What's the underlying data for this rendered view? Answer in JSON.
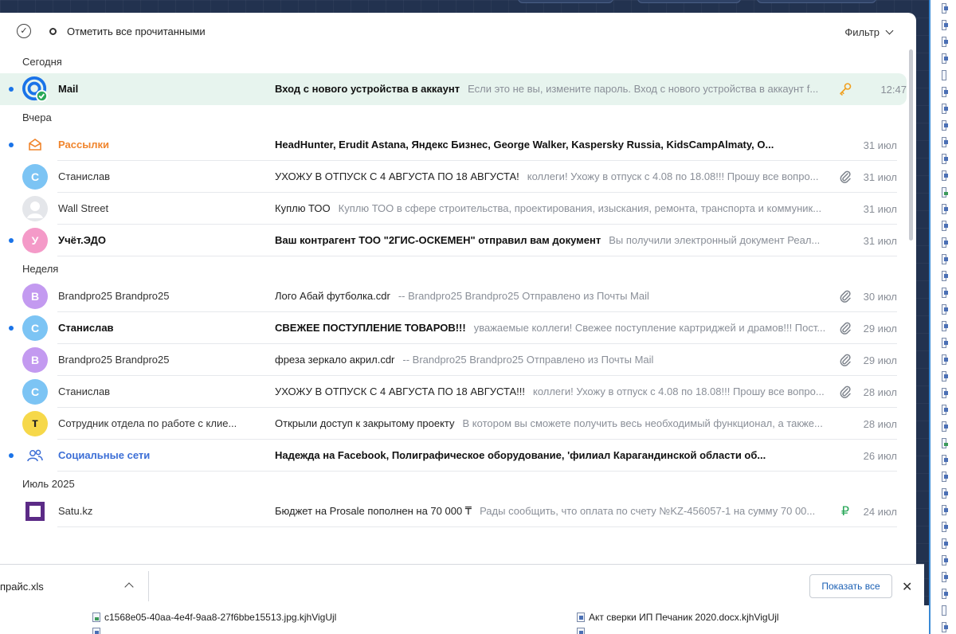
{
  "toolbar": {
    "mark_all_read": "Отметить все прочитанными",
    "filter": "Фильтр"
  },
  "groups": [
    {
      "title": "Сегодня",
      "items": [
        {
          "sender": "Mail",
          "subject": "Вход с нового устройства в аккаунт",
          "preview": "Если это не вы, измените пароль. Вход с нового устройства в аккаунт f...",
          "date": "12:47",
          "unread": true,
          "bold": true,
          "icon": "key-icon",
          "avatar_type": "mail-logo",
          "highlight": true
        }
      ]
    },
    {
      "title": "Вчера",
      "items": [
        {
          "sender": "Рассылки",
          "subject": "HeadHunter, Erudit Astana, Яндекс Бизнес, George Walker, Kaspersky Russia, KidsCampAlmaty, О...",
          "preview": "",
          "date": "31 июл",
          "unread": true,
          "bold": true,
          "avatar_type": "newsletter",
          "sender_color": "#f0852d"
        },
        {
          "sender": "Станислав",
          "subject": "УХОЖУ В ОТПУСК С 4 АВГУСТА ПО 18 АВГУСТА!",
          "preview": "коллеги! Ухожу в отпуск с 4.08 по 18.08!!! Прошу все вопро...",
          "date": "31 июл",
          "unread": false,
          "bold": false,
          "icon": "paperclip-icon",
          "avatar_letter": "С",
          "avatar_color": "#7cc4f4"
        },
        {
          "sender": "Wall Street",
          "subject": "Куплю ТОО",
          "preview": "Куплю ТОО в сфере строительства, проектирования, изыскания, ремонта, транспорта и коммуник...",
          "date": "31 июл",
          "unread": false,
          "bold": false,
          "avatar_type": "person"
        },
        {
          "sender": "Учёт.ЭДО",
          "subject": "Ваш контрагент ТОО \"2ГИС-ОСКЕМЕН\" отправил вам документ",
          "preview": "Вы получили электронный документ Реал...",
          "date": "31 июл",
          "unread": true,
          "bold": true,
          "avatar_letter": "У",
          "avatar_color": "#f49ac8"
        }
      ]
    },
    {
      "title": "Неделя",
      "items": [
        {
          "sender": "Brandpro25 Brandpro25",
          "subject": "Лого Абай футболка.cdr",
          "preview": "-- Brandpro25 Brandpro25 Отправлено из Почты Mail",
          "date": "30 июл",
          "unread": false,
          "bold": false,
          "icon": "paperclip-icon",
          "avatar_letter": "B",
          "avatar_color": "#c39af0"
        },
        {
          "sender": "Станислав",
          "subject": "СВЕЖЕЕ ПОСТУПЛЕНИЕ ТОВАРОВ!!!",
          "preview": "уважаемые коллеги! Свежее поступление картриджей и драмов!!! Пост...",
          "date": "29 июл",
          "unread": true,
          "bold": true,
          "icon": "paperclip-icon",
          "avatar_letter": "С",
          "avatar_color": "#7cc4f4"
        },
        {
          "sender": "Brandpro25 Brandpro25",
          "subject": "фреза зеркало акрил.cdr",
          "preview": "-- Brandpro25 Brandpro25 Отправлено из Почты Mail",
          "date": "29 июл",
          "unread": false,
          "bold": false,
          "icon": "paperclip-icon",
          "avatar_letter": "B",
          "avatar_color": "#c39af0"
        },
        {
          "sender": "Станислав",
          "subject": "УХОЖУ В ОТПУСК С 4 АВГУСТА ПО 18 АВГУСТА!!!",
          "preview": "коллеги! Ухожу в отпуск с 4.08 по 18.08!!! Прошу все вопро...",
          "date": "28 июл",
          "unread": false,
          "bold": false,
          "icon": "paperclip-icon",
          "avatar_letter": "С",
          "avatar_color": "#7cc4f4"
        },
        {
          "sender": "Сотрудник отдела по работе с клие...",
          "subject": "Открыли доступ к закрытому проекту",
          "preview": "В котором вы сможете получить весь необходимый функционал, а также...",
          "date": "28 июл",
          "unread": false,
          "bold": false,
          "avatar_letter": "т",
          "avatar_color": "#f6d84a"
        },
        {
          "sender": "Социальные сети",
          "subject": "Надежда на Facebook, Полиграфическое оборудование, 'филиал Карагандинской области об...",
          "preview": "",
          "date": "26 июл",
          "unread": true,
          "bold": true,
          "avatar_type": "social",
          "sender_color": "#3d6fd6"
        }
      ]
    },
    {
      "title": "Июль 2025",
      "items": [
        {
          "sender": "Satu.kz",
          "subject": "Бюджет на Prosale пополнен на 70 000 ₸",
          "preview": "Рады сообщить, что оплата по счету №KZ-456057-1 на сумму 70 00...",
          "date": "24 июл",
          "unread": false,
          "bold": false,
          "icon": "ruble-icon",
          "avatar_type": "satu"
        }
      ]
    }
  ],
  "download_bar": {
    "file_name": "прайс.xls",
    "show_all": "Показать все"
  },
  "bottom_files": [
    "c1568e05-40aa-4e4f-9aa8-27f6bbe15513.jpg.kjhVigUjl",
    "Акт сверки ИП Печаник 2020.docx.kjhVigUjl"
  ],
  "colors": {
    "accent": "#1a73e8",
    "highlight_row": "#e7f4ee",
    "unread_dot": "#1a73e8",
    "key_icon": "#f0a020",
    "ruble_icon": "#2aa85a"
  }
}
